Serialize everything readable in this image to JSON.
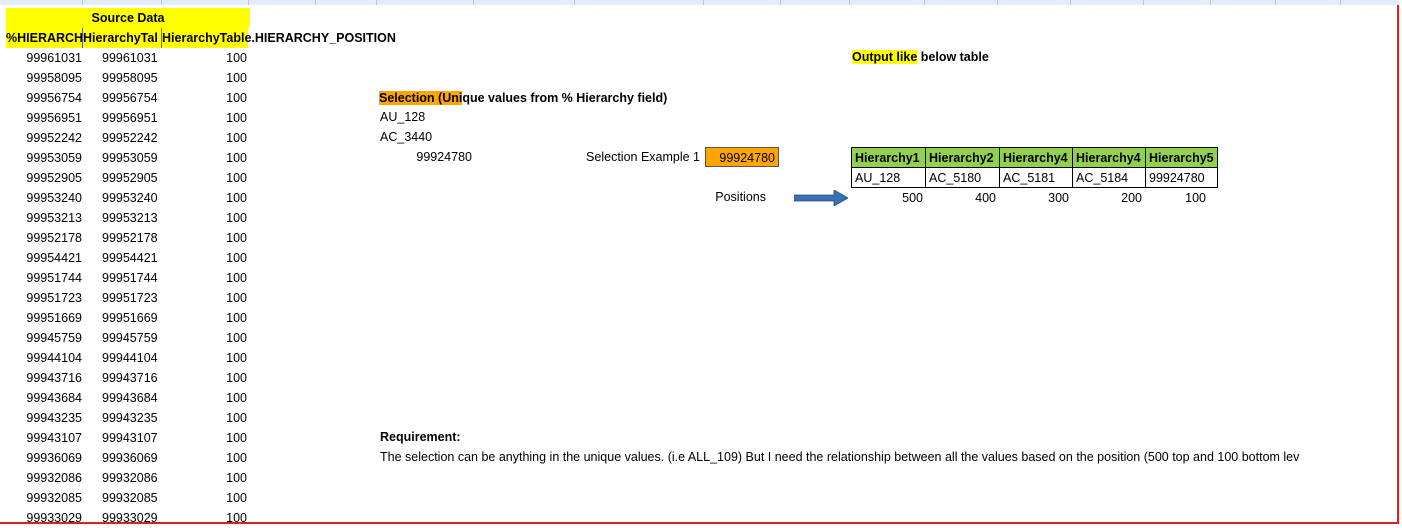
{
  "source": {
    "title": "Source Data",
    "headers": [
      "%HIERARCH",
      "HierarchyTal",
      "HierarchyTable.HIERARCHY_POSITION"
    ],
    "rows": [
      [
        "99961031",
        "99961031",
        "100"
      ],
      [
        "99958095",
        "99958095",
        "100"
      ],
      [
        "99956754",
        "99956754",
        "100"
      ],
      [
        "99956951",
        "99956951",
        "100"
      ],
      [
        "99952242",
        "99952242",
        "100"
      ],
      [
        "99953059",
        "99953059",
        "100"
      ],
      [
        "99952905",
        "99952905",
        "100"
      ],
      [
        "99953240",
        "99953240",
        "100"
      ],
      [
        "99953213",
        "99953213",
        "100"
      ],
      [
        "99952178",
        "99952178",
        "100"
      ],
      [
        "99954421",
        "99954421",
        "100"
      ],
      [
        "99951744",
        "99951744",
        "100"
      ],
      [
        "99951723",
        "99951723",
        "100"
      ],
      [
        "99951669",
        "99951669",
        "100"
      ],
      [
        "99945759",
        "99945759",
        "100"
      ],
      [
        "99944104",
        "99944104",
        "100"
      ],
      [
        "99943716",
        "99943716",
        "100"
      ],
      [
        "99943684",
        "99943684",
        "100"
      ],
      [
        "99943235",
        "99943235",
        "100"
      ],
      [
        "99943107",
        "99943107",
        "100"
      ],
      [
        "99936069",
        "99936069",
        "100"
      ],
      [
        "99932086",
        "99932086",
        "100"
      ],
      [
        "99932085",
        "99932085",
        "100"
      ],
      [
        "99933029",
        "99933029",
        "100"
      ]
    ]
  },
  "selection": {
    "title": "Selection (Unique values from % Hierarchy field)",
    "title_highlight": "Selection (Uni",
    "title_rest": "que values from % Hierarchy field)",
    "values": [
      "AU_128",
      "AC_3440",
      "99924780"
    ],
    "example_label": "Selection Example 1",
    "example_value": "99924780"
  },
  "output": {
    "title_highlight": "Output like",
    "title_rest": " below table",
    "headers": [
      "Hierarchy1",
      "Hierarchy2",
      "Hierarchy4",
      "Hierarchy4",
      "Hierarchy5"
    ],
    "values": [
      "AU_128",
      "AC_5180",
      "AC_5181",
      "AC_5184",
      "99924780"
    ],
    "positions_label": "Positions",
    "positions": [
      "500",
      "400",
      "300",
      "200",
      "100"
    ]
  },
  "requirement": {
    "title": "Requirement:",
    "text": "The selection can be anything in the unique values. (i.e ALL_109) But I need the relationship between all the values based on the position (500 top and 100 bottom lev"
  },
  "colors": {
    "yellow": "#ffff00",
    "orange": "#ffa500",
    "green": "#92d050",
    "arrow": "#3a6fb0",
    "frame": "#e02020"
  }
}
